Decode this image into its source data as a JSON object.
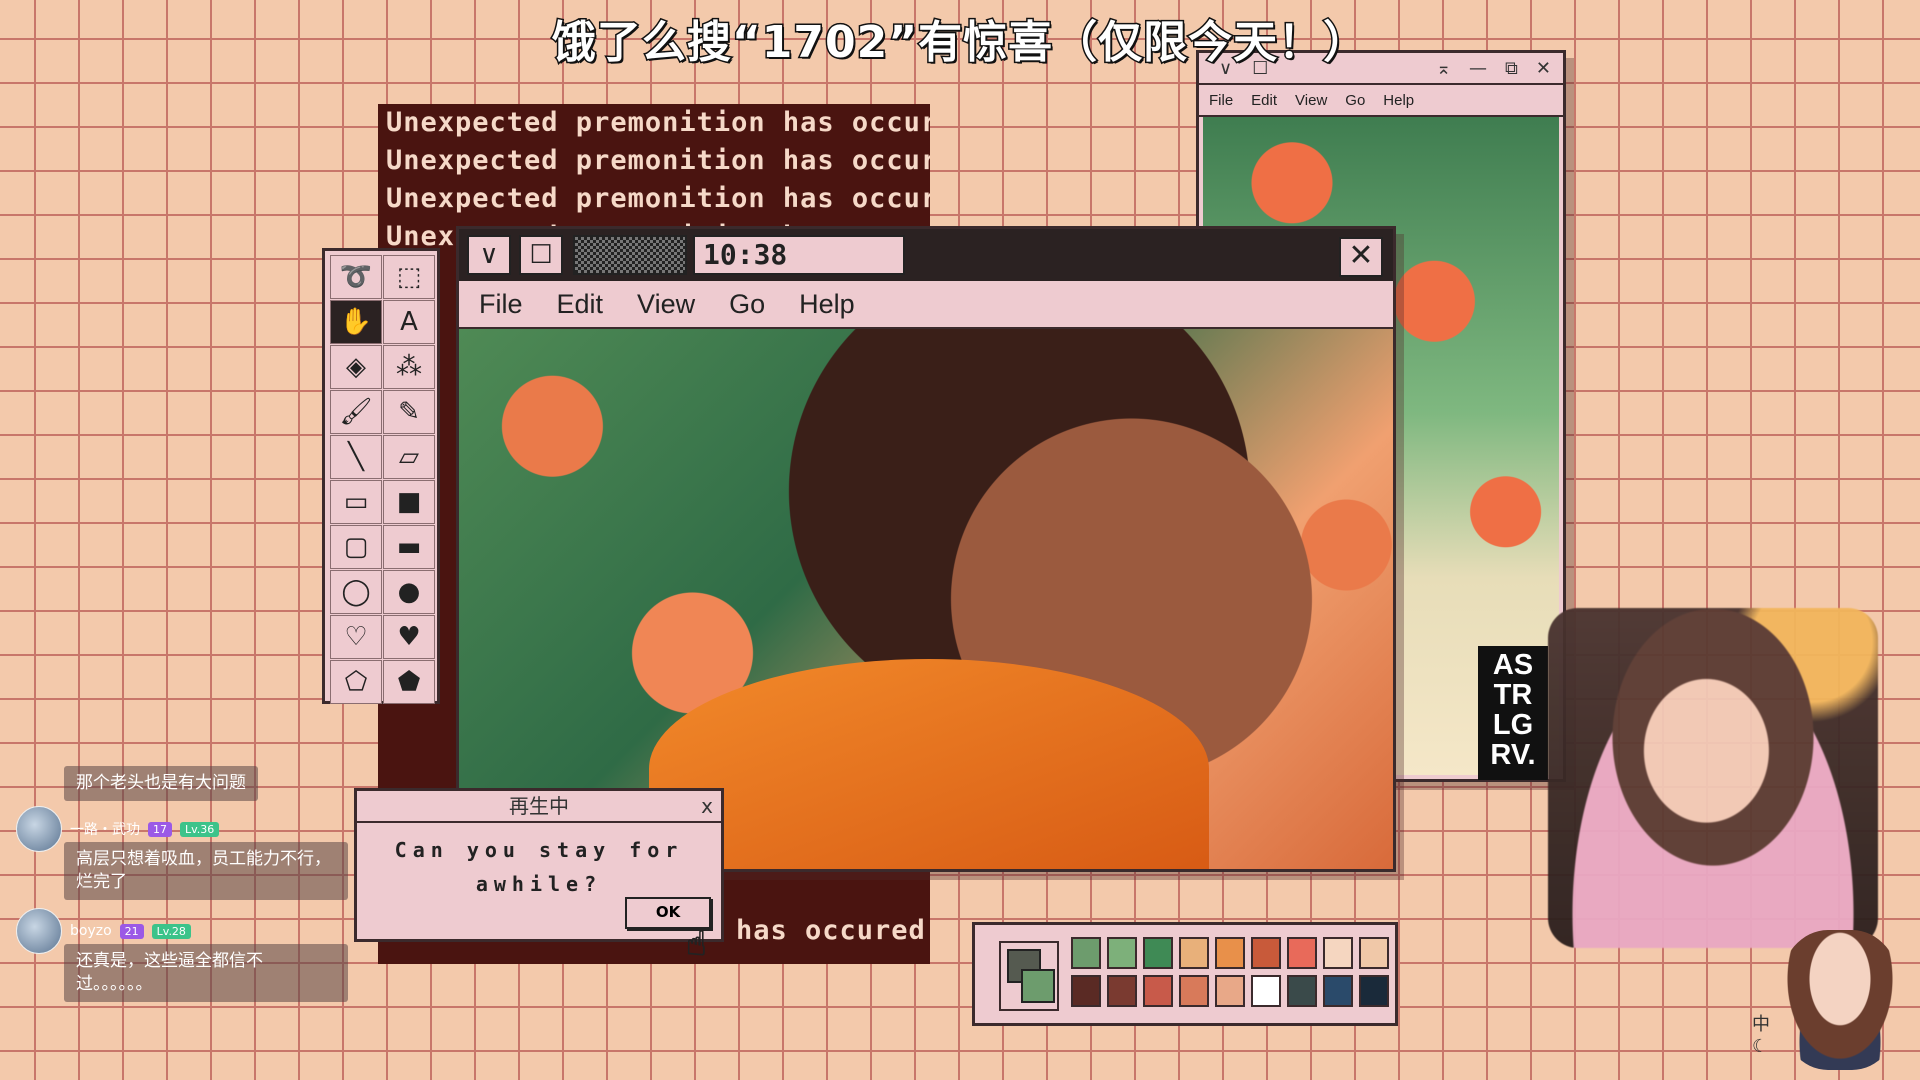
{
  "banner": {
    "text": "饿了么搜“1702”有惊喜（仅限今天！）"
  },
  "premonition": {
    "lines": [
      "Unexpected premonition has occured",
      "Unexpected premonition has occured",
      "Unexpected premonition has occured",
      "Unexpected premonition has occured"
    ],
    "bottom_fragment": "has occured"
  },
  "main_window": {
    "time": "10:38",
    "menu": [
      "File",
      "Edit",
      "View",
      "Go",
      "Help"
    ],
    "close_glyph": "✕",
    "collapse_glyph": "∨",
    "maximize_glyph": "☐"
  },
  "right_window": {
    "menu": [
      "File",
      "Edit",
      "View",
      "Go",
      "Help"
    ],
    "controls": [
      "∨",
      "☐",
      "⌅",
      "—",
      "⧉",
      "✕"
    ],
    "logo_text": [
      "AS",
      "TR",
      "LG",
      "RV."
    ]
  },
  "toolbox": {
    "tools": [
      {
        "name": "lasso-tool",
        "glyph": "➰"
      },
      {
        "name": "select-rect-tool",
        "glyph": "⬚"
      },
      {
        "name": "hand-tool",
        "glyph": "✋"
      },
      {
        "name": "text-tool",
        "glyph": "A"
      },
      {
        "name": "fill-tool",
        "glyph": "◈"
      },
      {
        "name": "spray-tool",
        "glyph": "⁂"
      },
      {
        "name": "brush-tool",
        "glyph": "🖌"
      },
      {
        "name": "pencil-tool",
        "glyph": "✎"
      },
      {
        "name": "line-tool",
        "glyph": "╲"
      },
      {
        "name": "eraser-tool",
        "glyph": "▱"
      },
      {
        "name": "rect-tool",
        "glyph": "▭"
      },
      {
        "name": "filled-rect-tool",
        "glyph": "■"
      },
      {
        "name": "round-rect-tool",
        "glyph": "▢"
      },
      {
        "name": "filled-round-rect-tool",
        "glyph": "▬"
      },
      {
        "name": "ellipse-tool",
        "glyph": "◯"
      },
      {
        "name": "filled-ellipse-tool",
        "glyph": "●"
      },
      {
        "name": "heart-tool",
        "glyph": "♡"
      },
      {
        "name": "filled-heart-tool",
        "glyph": "♥"
      },
      {
        "name": "polygon-tool",
        "glyph": "⬠"
      },
      {
        "name": "filled-polygon-tool",
        "glyph": "⬟"
      }
    ]
  },
  "palette": {
    "colors": [
      "#6d9c6d",
      "#7db07a",
      "#3f8a55",
      "#e8b07a",
      "#e8904a",
      "#c85a3a",
      "#e86a5a",
      "#f5d6c0",
      "#f0c8a8",
      "#5a2a24",
      "#7a3a30",
      "#c85a4a",
      "#d87a5a",
      "#e8a888",
      "#ffffff",
      "#3a4a4a",
      "#2a4a6a",
      "#1a2a3a"
    ]
  },
  "dialog": {
    "title": "再生中",
    "close": "x",
    "message_line1": "Can you stay for",
    "message_line2": "awhile?",
    "ok_label": "OK"
  },
  "chat": [
    {
      "message": "那个老头也是有大问题"
    },
    {
      "username": "一路・武功",
      "badge1": "17",
      "badge2": "Lv.36",
      "message": "高层只想着吸血，员工能力不行，烂完了"
    },
    {
      "username": "boyzo",
      "badge1": "21",
      "badge2": "Lv.28",
      "message": "还真是，这些逼全都信不过。。。。。。"
    }
  ],
  "ime": {
    "lang": "中",
    "moon": "☾"
  }
}
